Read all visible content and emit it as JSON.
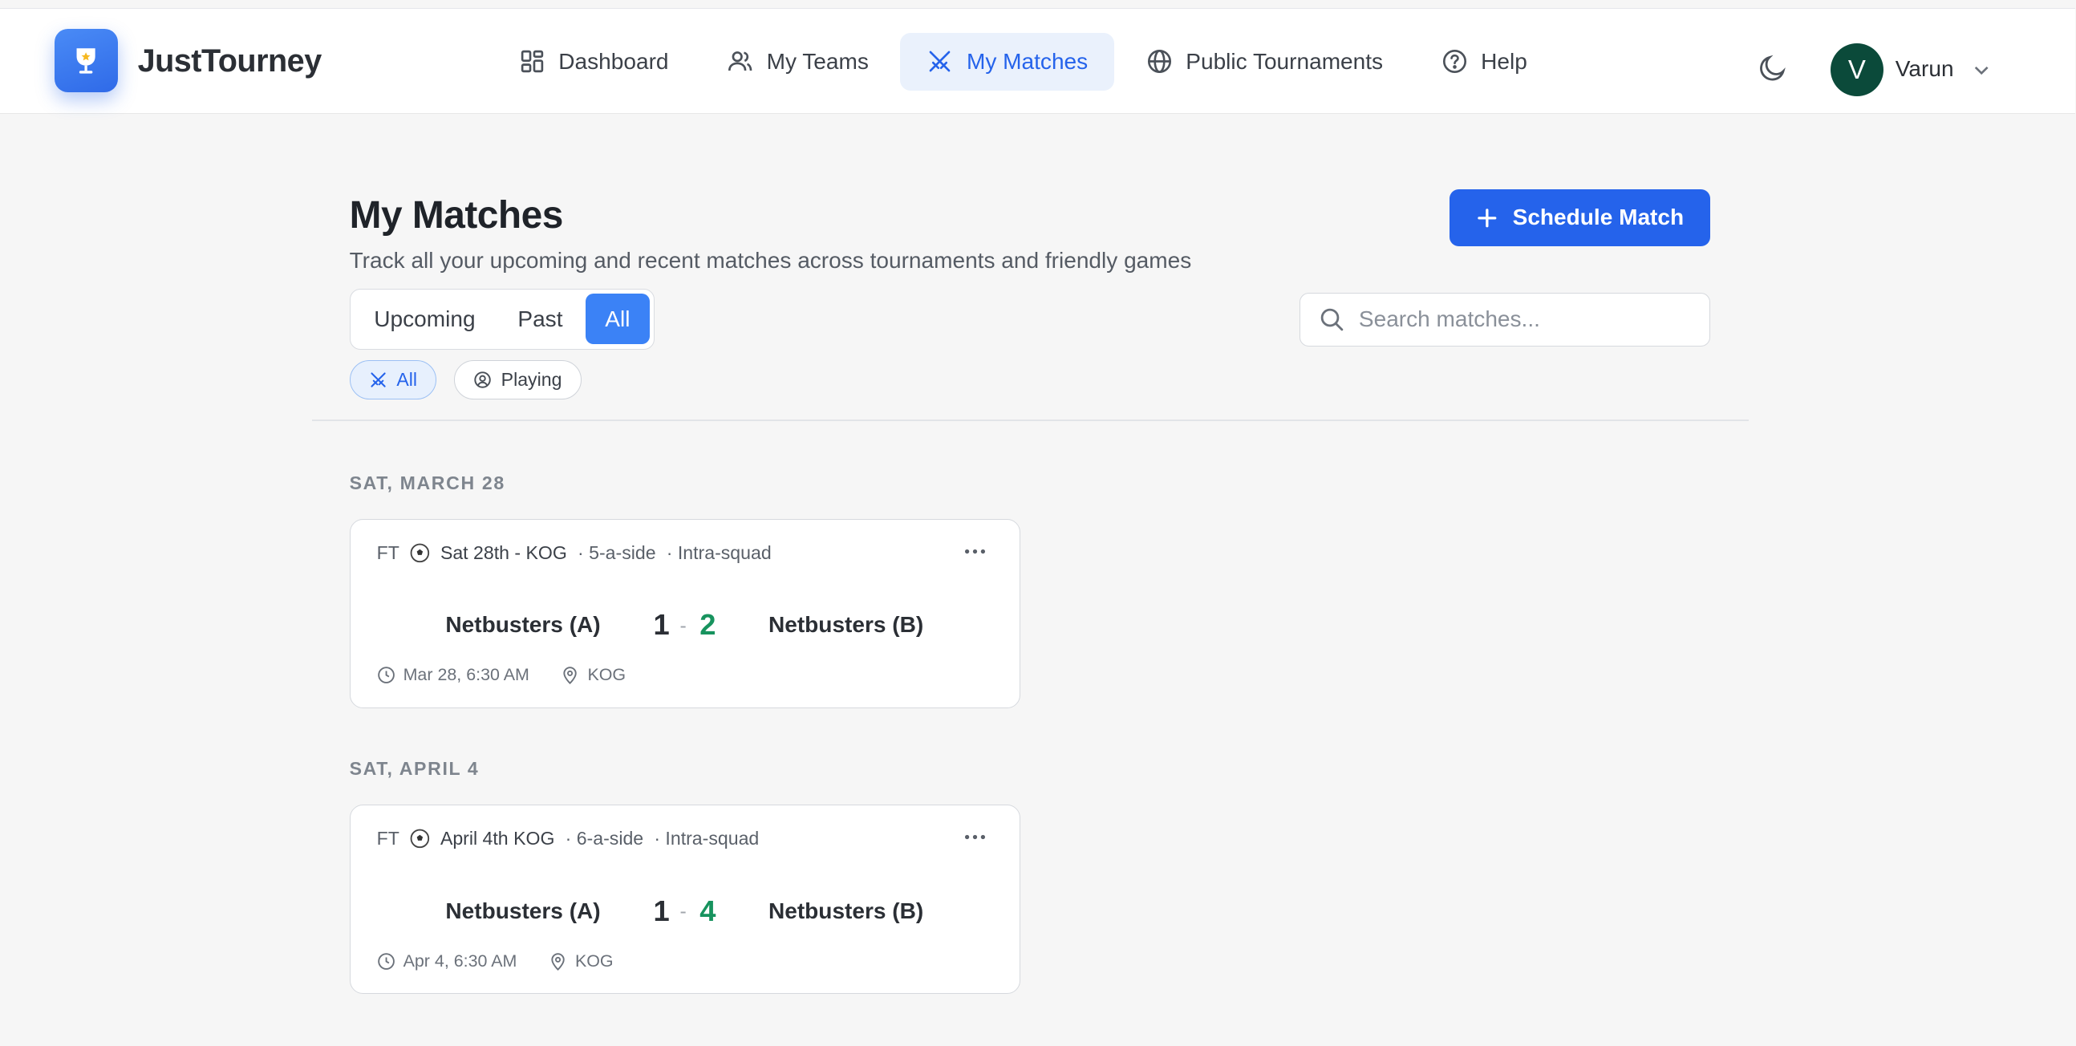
{
  "app": {
    "name": "JustTourney"
  },
  "nav": {
    "items": [
      {
        "label": "Dashboard",
        "icon": "dashboard-icon"
      },
      {
        "label": "My Teams",
        "icon": "users-icon"
      },
      {
        "label": "My Matches",
        "icon": "swords-icon",
        "active": true
      },
      {
        "label": "Public Tournaments",
        "icon": "globe-icon"
      },
      {
        "label": "Help",
        "icon": "help-circle-icon"
      }
    ]
  },
  "user": {
    "initial": "V",
    "name": "Varun",
    "avatar_color": "#0b4a3a"
  },
  "page": {
    "title": "My Matches",
    "subtitle": "Track all your upcoming and recent matches across tournaments and friendly games",
    "schedule_button": "Schedule Match"
  },
  "filters": {
    "segments": [
      {
        "label": "Upcoming"
      },
      {
        "label": "Past"
      },
      {
        "label": "All",
        "active": true
      }
    ],
    "chips": [
      {
        "label": "All",
        "active": true
      },
      {
        "label": "Playing"
      }
    ],
    "search_placeholder": "Search matches..."
  },
  "match_groups": [
    {
      "date": "SAT, MARCH 28",
      "matches": [
        {
          "status": "FT",
          "title": "Sat 28th - KOG",
          "format": "· 5-a-side",
          "type": "· Intra-squad",
          "home_team": "Netbusters (A)",
          "away_team": "Netbusters (B)",
          "home_score": "1",
          "away_score": "2",
          "separator": "-",
          "time": "Mar 28, 6:30 AM",
          "venue": "KOG"
        }
      ]
    },
    {
      "date": "SAT, APRIL 4",
      "matches": [
        {
          "status": "FT",
          "title": "April 4th KOG",
          "format": "· 6-a-side",
          "type": "· Intra-squad",
          "home_team": "Netbusters (A)",
          "away_team": "Netbusters (B)",
          "home_score": "1",
          "away_score": "4",
          "separator": "-",
          "time": "Apr 4, 6:30 AM",
          "venue": "KOG"
        }
      ]
    }
  ],
  "colors": {
    "accent": "#2563eb",
    "segment_active": "#3b82f6",
    "winning_score": "#17935e"
  }
}
